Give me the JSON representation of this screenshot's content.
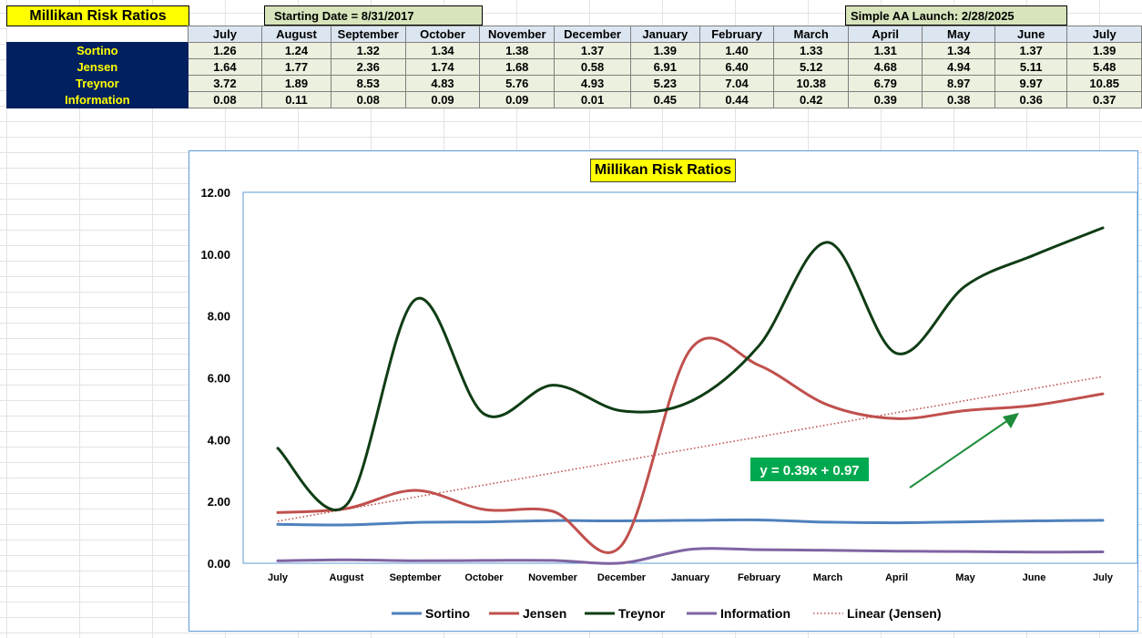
{
  "header": {
    "title": "Millikan Risk Ratios",
    "start_label": "Starting Date = 8/31/2017",
    "launch_label": "Simple AA Launch: 2/28/2025"
  },
  "table": {
    "months": [
      "July",
      "August",
      "September",
      "October",
      "November",
      "December",
      "January",
      "February",
      "March",
      "April",
      "May",
      "June",
      "July"
    ],
    "rows": [
      {
        "label": "Sortino",
        "values": [
          "1.26",
          "1.24",
          "1.32",
          "1.34",
          "1.38",
          "1.37",
          "1.39",
          "1.40",
          "1.33",
          "1.31",
          "1.34",
          "1.37",
          "1.39"
        ]
      },
      {
        "label": "Jensen",
        "values": [
          "1.64",
          "1.77",
          "2.36",
          "1.74",
          "1.68",
          "0.58",
          "6.91",
          "6.40",
          "5.12",
          "4.68",
          "4.94",
          "5.11",
          "5.48"
        ]
      },
      {
        "label": "Treynor",
        "values": [
          "3.72",
          "1.89",
          "8.53",
          "4.83",
          "5.76",
          "4.93",
          "5.23",
          "7.04",
          "10.38",
          "6.79",
          "8.97",
          "9.97",
          "10.85"
        ]
      },
      {
        "label": "Information",
        "values": [
          "0.08",
          "0.11",
          "0.08",
          "0.09",
          "0.09",
          "0.01",
          "0.45",
          "0.44",
          "0.42",
          "0.39",
          "0.38",
          "0.36",
          "0.37"
        ]
      }
    ]
  },
  "chart_data": {
    "type": "line",
    "title": "Millikan Risk Ratios",
    "categories": [
      "July",
      "August",
      "September",
      "October",
      "November",
      "December",
      "January",
      "February",
      "March",
      "April",
      "May",
      "June",
      "July"
    ],
    "ylim": [
      0,
      12
    ],
    "yticks": [
      "0.00",
      "2.00",
      "4.00",
      "6.00",
      "8.00",
      "10.00",
      "12.00"
    ],
    "series": [
      {
        "name": "Sortino",
        "color": "#4f81bd",
        "values": [
          1.26,
          1.24,
          1.32,
          1.34,
          1.38,
          1.37,
          1.39,
          1.4,
          1.33,
          1.31,
          1.34,
          1.37,
          1.39
        ]
      },
      {
        "name": "Jensen",
        "color": "#c0504d",
        "values": [
          1.64,
          1.77,
          2.36,
          1.74,
          1.68,
          0.58,
          6.91,
          6.4,
          5.12,
          4.68,
          4.94,
          5.11,
          5.48
        ]
      },
      {
        "name": "Treynor",
        "color": "#0f3d14",
        "values": [
          3.72,
          1.89,
          8.53,
          4.83,
          5.76,
          4.93,
          5.23,
          7.04,
          10.38,
          6.79,
          8.97,
          9.97,
          10.85
        ]
      },
      {
        "name": "Information",
        "color": "#8064a2",
        "values": [
          0.08,
          0.11,
          0.08,
          0.09,
          0.09,
          0.01,
          0.45,
          0.44,
          0.42,
          0.39,
          0.38,
          0.36,
          0.37
        ]
      }
    ],
    "trendline": {
      "name": "Linear (Jensen)",
      "color": "#c0504d",
      "slope": 0.39,
      "intercept": 0.97,
      "style": "dotted"
    },
    "equation_label": "y = 0.39x + 0.97",
    "equation_color": "#00a94f",
    "arrow_color": "#1e8c3a",
    "legend_position": "bottom",
    "grid": false
  }
}
